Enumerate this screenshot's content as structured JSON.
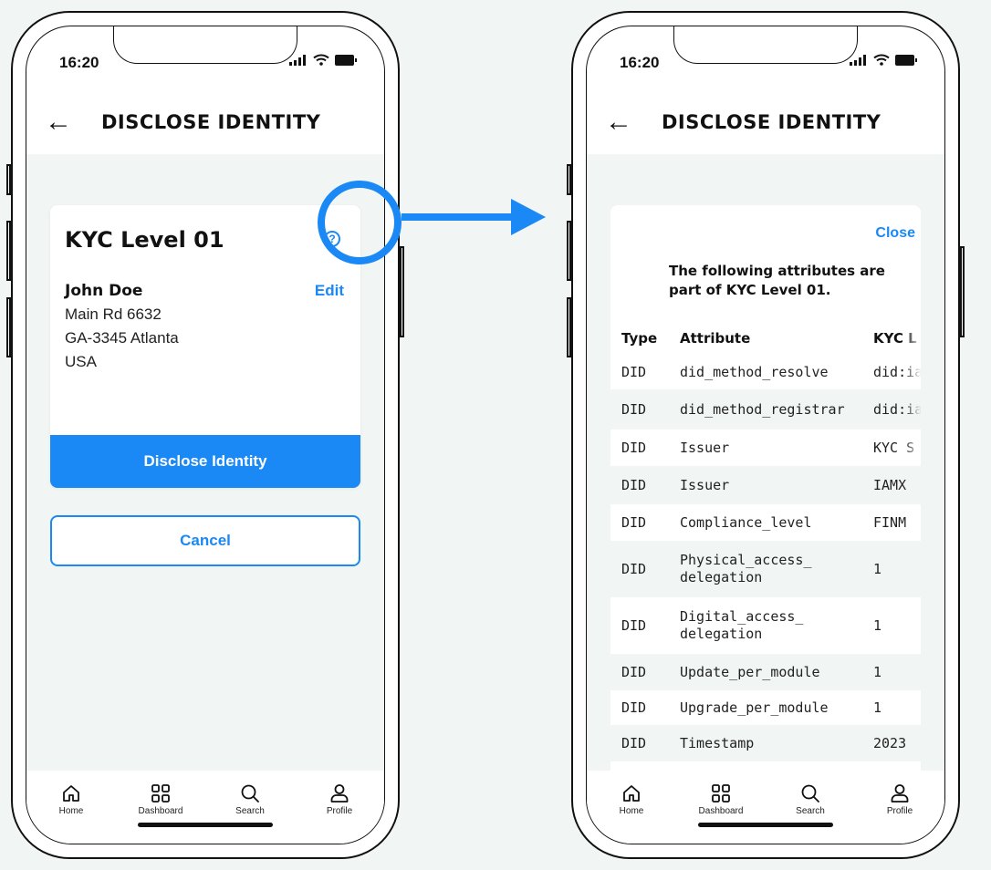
{
  "colors": {
    "accent": "#1a88f5",
    "background": "#f1f5f4",
    "text": "#111111"
  },
  "left_phone": {
    "status": {
      "time": "16:20"
    },
    "header": {
      "title": "DISCLOSE IDENTITY"
    },
    "card": {
      "title": "KYC Level 01",
      "help_icon_text": "?",
      "edit_label": "Edit",
      "name": "John Doe",
      "address_lines": [
        "Main Rd 6632",
        "GA-3345 Atlanta",
        "USA"
      ],
      "primary_button": "Disclose Identity"
    },
    "cancel_button": "Cancel"
  },
  "right_phone": {
    "status": {
      "time": "16:20"
    },
    "header": {
      "title": "DISCLOSE IDENTITY"
    },
    "panel": {
      "close_label": "Close",
      "intro": "The following attributes are part of KYC Level 01.",
      "columns": [
        "Type",
        "Attribute",
        "KYC L"
      ],
      "rows": [
        {
          "type": "DID",
          "attribute": "did_method_resolve",
          "value": "did:ia"
        },
        {
          "type": "DID",
          "attribute": "did_method_registrar",
          "value": "did:ia"
        },
        {
          "type": "DID",
          "attribute": "Issuer",
          "value": "KYC S"
        },
        {
          "type": "DID",
          "attribute": "Issuer",
          "value": "IAMX"
        },
        {
          "type": "DID",
          "attribute": "Compliance_level",
          "value": "FINM"
        },
        {
          "type": "DID",
          "attribute": "Physical_access_ delegation",
          "value": "1"
        },
        {
          "type": "DID",
          "attribute": "Digital_access_ delegation",
          "value": "1"
        },
        {
          "type": "DID",
          "attribute": "Update_per_module",
          "value": "1"
        },
        {
          "type": "DID",
          "attribute": "Upgrade_per_module",
          "value": "1"
        },
        {
          "type": "DID",
          "attribute": "Timestamp",
          "value": "2023"
        }
      ]
    }
  },
  "nav": [
    {
      "label": "Home",
      "icon": "home-icon"
    },
    {
      "label": "Dashboard",
      "icon": "dashboard-icon"
    },
    {
      "label": "Search",
      "icon": "search-icon"
    },
    {
      "label": "Profile",
      "icon": "profile-icon"
    }
  ]
}
